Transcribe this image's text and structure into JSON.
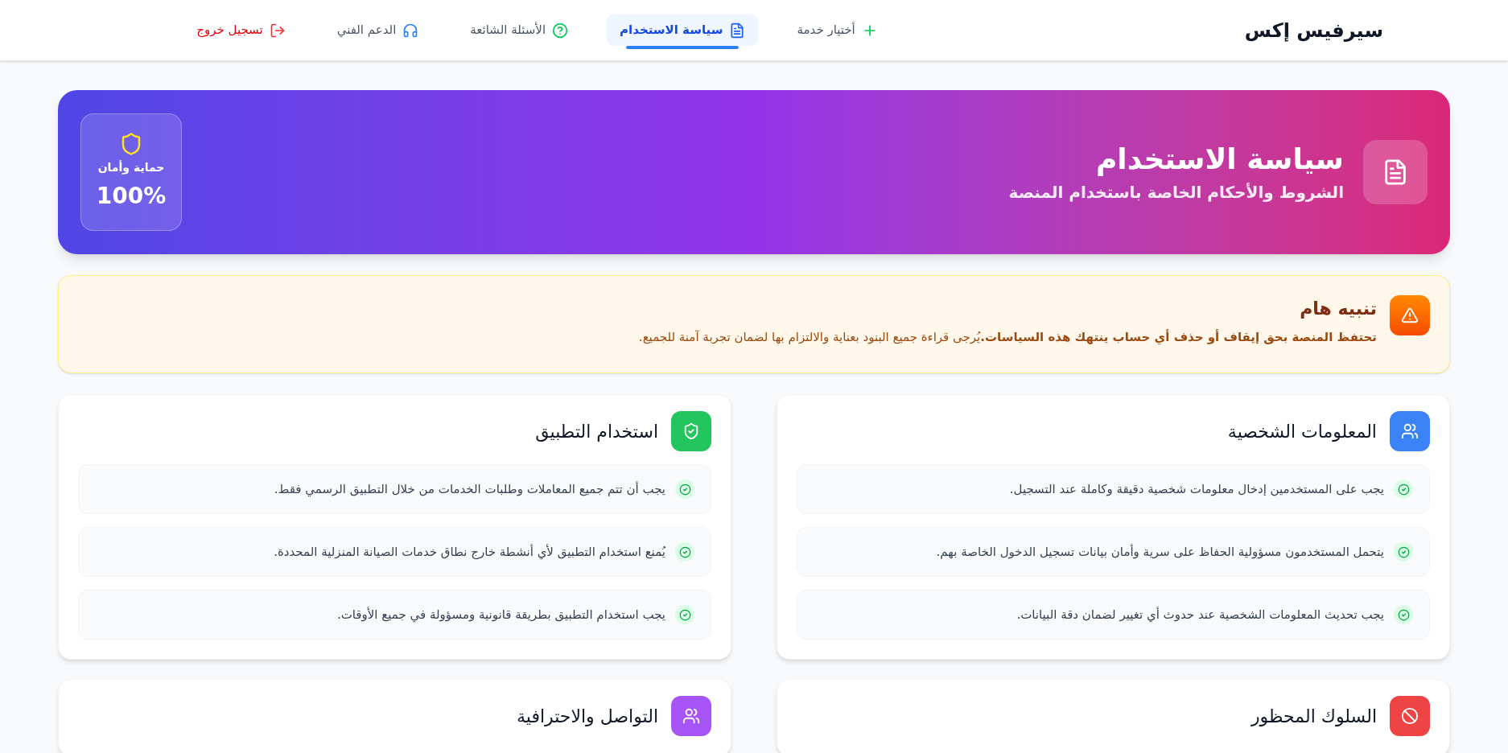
{
  "brand": "سيرفيس إكس",
  "nav": [
    {
      "label": "أختيار خدمة",
      "kind": "add",
      "selected": false
    },
    {
      "label": "سياسة الاستخدام",
      "kind": "policy",
      "selected": true
    },
    {
      "label": "الأسئلة الشائعة",
      "kind": "faq",
      "selected": false
    },
    {
      "label": "الدعم الفني",
      "kind": "support",
      "selected": false
    },
    {
      "label": "تسجيل خروج",
      "kind": "logout",
      "selected": false
    }
  ],
  "banner": {
    "title": "سياسة الاستخدام",
    "subtitle": "الشروط والأحكام الخاصة باستخدام المنصة",
    "badge_label": "حماية وأمان",
    "badge_value": "100%"
  },
  "alert": {
    "title": "تنبيه هام",
    "text": "**تحتفظ المنصة بحق إيقاف أو حذف أي حساب ينتهك هذه السياسات.**يُرجى قراءة جميع البنود بعناية والالتزام بها لضمان تجربة آمنة للجميع."
  },
  "sections": [
    {
      "title": "المعلومات الشخصية",
      "color": "#3b82f6",
      "items": [
        "يجب على المستخدمين إدخال معلومات شخصية دقيقة وكاملة عند التسجيل.",
        "يتحمل المستخدمون مسؤولية الحفاظ على سرية وأمان بيانات تسجيل الدخول الخاصة بهم.",
        "يجب تحديث المعلومات الشخصية عند حدوث أي تغيير لضمان دقة البيانات."
      ]
    },
    {
      "title": "استخدام التطبيق",
      "color": "#22c55e",
      "items": [
        "يجب أن تتم جميع المعاملات وطلبات الخدمات من خلال التطبيق الرسمي فقط.",
        "يُمنع استخدام التطبيق لأي أنشطة خارج نطاق خدمات الصيانة المنزلية المحددة.",
        "يجب استخدام التطبيق بطريقة قانونية ومسؤولة في جميع الأوقات."
      ]
    },
    {
      "title": "السلوك المحظور",
      "color": "#ef4444"
    },
    {
      "title": "التواصل والاحترافية",
      "color": "#a855f7"
    }
  ]
}
